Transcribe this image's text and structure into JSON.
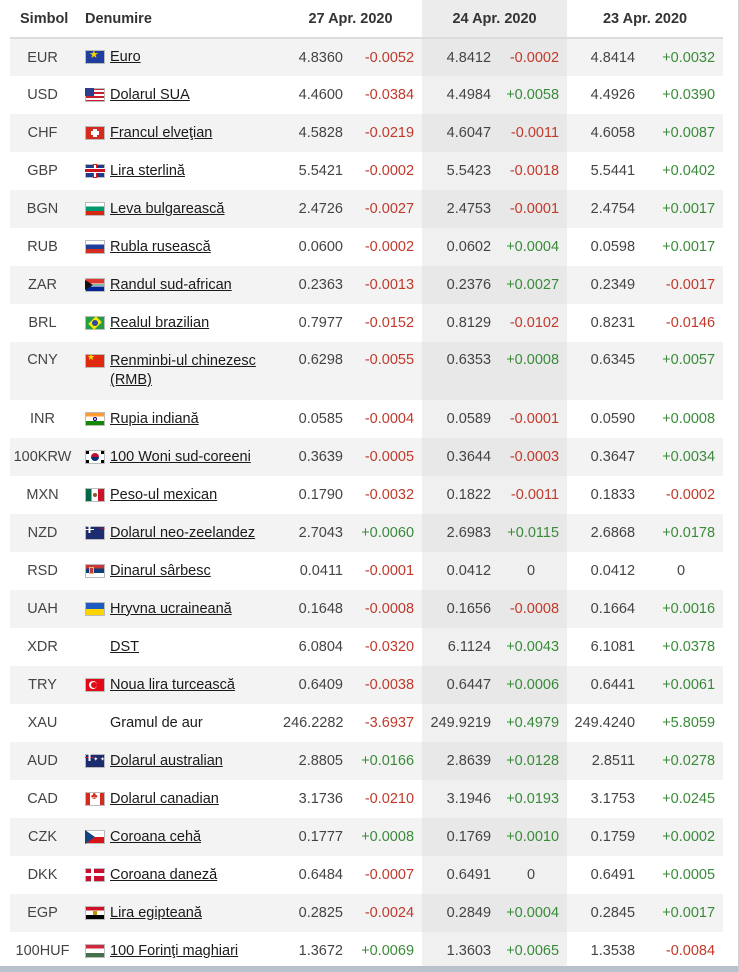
{
  "headers": {
    "symbol": "Simbol",
    "name": "Denumire",
    "dates": [
      "27 Apr. 2020",
      "24 Apr. 2020",
      "23 Apr. 2020"
    ]
  },
  "colors": {
    "negative": "#c0392b",
    "positive": "#3a8a3a",
    "shaded_column": "#e8e8e8",
    "odd_row": "#f3f3f3"
  },
  "rows": [
    {
      "symbol": "EUR",
      "name": "Euro",
      "flag": "eu-flag-icon",
      "linked": true,
      "v1": "4.8360",
      "c1": "-0.0052",
      "v2": "4.8412",
      "c2": "-0.0002",
      "v3": "4.8414",
      "c3": "+0.0032"
    },
    {
      "symbol": "USD",
      "name": "Dolarul SUA",
      "flag": "us-flag-icon",
      "linked": true,
      "v1": "4.4600",
      "c1": "-0.0384",
      "v2": "4.4984",
      "c2": "+0.0058",
      "v3": "4.4926",
      "c3": "+0.0390"
    },
    {
      "symbol": "CHF",
      "name": "Francul elveţian",
      "flag": "ch-flag-icon",
      "linked": true,
      "v1": "4.5828",
      "c1": "-0.0219",
      "v2": "4.6047",
      "c2": "-0.0011",
      "v3": "4.6058",
      "c3": "+0.0087"
    },
    {
      "symbol": "GBP",
      "name": "Lira sterlină",
      "flag": "gb-flag-icon",
      "linked": true,
      "v1": "5.5421",
      "c1": "-0.0002",
      "v2": "5.5423",
      "c2": "-0.0018",
      "v3": "5.5441",
      "c3": "+0.0402"
    },
    {
      "symbol": "BGN",
      "name": "Leva bulgarească",
      "flag": "bg-flag-icon",
      "linked": true,
      "v1": "2.4726",
      "c1": "-0.0027",
      "v2": "2.4753",
      "c2": "-0.0001",
      "v3": "2.4754",
      "c3": "+0.0017"
    },
    {
      "symbol": "RUB",
      "name": "Rubla rusească",
      "flag": "ru-flag-icon",
      "linked": true,
      "v1": "0.0600",
      "c1": "-0.0002",
      "v2": "0.0602",
      "c2": "+0.0004",
      "v3": "0.0598",
      "c3": "+0.0017"
    },
    {
      "symbol": "ZAR",
      "name": "Randul sud-african",
      "flag": "za-flag-icon",
      "linked": true,
      "v1": "0.2363",
      "c1": "-0.0013",
      "v2": "0.2376",
      "c2": "+0.0027",
      "v3": "0.2349",
      "c3": "-0.0017"
    },
    {
      "symbol": "BRL",
      "name": "Realul brazilian",
      "flag": "br-flag-icon",
      "linked": true,
      "v1": "0.7977",
      "c1": "-0.0152",
      "v2": "0.8129",
      "c2": "-0.0102",
      "v3": "0.8231",
      "c3": "-0.0146"
    },
    {
      "symbol": "CNY",
      "name": "Renminbi-ul chinezesc (RMB)",
      "flag": "cn-flag-icon",
      "linked": true,
      "tall": true,
      "v1": "0.6298",
      "c1": "-0.0055",
      "v2": "0.6353",
      "c2": "+0.0008",
      "v3": "0.6345",
      "c3": "+0.0057"
    },
    {
      "symbol": "INR",
      "name": "Rupia indiană",
      "flag": "in-flag-icon",
      "linked": true,
      "v1": "0.0585",
      "c1": "-0.0004",
      "v2": "0.0589",
      "c2": "-0.0001",
      "v3": "0.0590",
      "c3": "+0.0008"
    },
    {
      "symbol": "100KRW",
      "name": "100 Woni sud-coreeni",
      "flag": "kr-flag-icon",
      "linked": true,
      "v1": "0.3639",
      "c1": "-0.0005",
      "v2": "0.3644",
      "c2": "-0.0003",
      "v3": "0.3647",
      "c3": "+0.0034"
    },
    {
      "symbol": "MXN",
      "name": "Peso-ul mexican",
      "flag": "mx-flag-icon",
      "linked": true,
      "v1": "0.1790",
      "c1": "-0.0032",
      "v2": "0.1822",
      "c2": "-0.0011",
      "v3": "0.1833",
      "c3": "-0.0002"
    },
    {
      "symbol": "NZD",
      "name": "Dolarul neo-zeelandez",
      "flag": "nz-flag-icon",
      "linked": true,
      "v1": "2.7043",
      "c1": "+0.0060",
      "v2": "2.6983",
      "c2": "+0.0115",
      "v3": "2.6868",
      "c3": "+0.0178"
    },
    {
      "symbol": "RSD",
      "name": "Dinarul sârbesc",
      "flag": "rs-flag-icon",
      "linked": true,
      "v1": "0.0411",
      "c1": "-0.0001",
      "v2": "0.0412",
      "c2": "0",
      "v3": "0.0412",
      "c3": "0"
    },
    {
      "symbol": "UAH",
      "name": "Hryvna ucraineană",
      "flag": "ua-flag-icon",
      "linked": true,
      "v1": "0.1648",
      "c1": "-0.0008",
      "v2": "0.1656",
      "c2": "-0.0008",
      "v3": "0.1664",
      "c3": "+0.0016"
    },
    {
      "symbol": "XDR",
      "name": "DST",
      "flag": "",
      "linked": true,
      "v1": "6.0804",
      "c1": "-0.0320",
      "v2": "6.1124",
      "c2": "+0.0043",
      "v3": "6.1081",
      "c3": "+0.0378"
    },
    {
      "symbol": "TRY",
      "name": "Noua lira turcească",
      "flag": "tr-flag-icon",
      "linked": true,
      "v1": "0.6409",
      "c1": "-0.0038",
      "v2": "0.6447",
      "c2": "+0.0006",
      "v3": "0.6441",
      "c3": "+0.0061"
    },
    {
      "symbol": "XAU",
      "name": "Gramul de aur",
      "flag": "",
      "linked": false,
      "v1": "246.2282",
      "c1": "-3.6937",
      "v2": "249.9219",
      "c2": "+0.4979",
      "v3": "249.4240",
      "c3": "+5.8059"
    },
    {
      "symbol": "AUD",
      "name": "Dolarul australian",
      "flag": "au-flag-icon",
      "linked": true,
      "v1": "2.8805",
      "c1": "+0.0166",
      "v2": "2.8639",
      "c2": "+0.0128",
      "v3": "2.8511",
      "c3": "+0.0278"
    },
    {
      "symbol": "CAD",
      "name": "Dolarul canadian",
      "flag": "ca-flag-icon",
      "linked": true,
      "v1": "3.1736",
      "c1": "-0.0210",
      "v2": "3.1946",
      "c2": "+0.0193",
      "v3": "3.1753",
      "c3": "+0.0245"
    },
    {
      "symbol": "CZK",
      "name": "Coroana cehă",
      "flag": "cz-flag-icon",
      "linked": true,
      "v1": "0.1777",
      "c1": "+0.0008",
      "v2": "0.1769",
      "c2": "+0.0010",
      "v3": "0.1759",
      "c3": "+0.0002"
    },
    {
      "symbol": "DKK",
      "name": "Coroana daneză",
      "flag": "dk-flag-icon",
      "linked": true,
      "v1": "0.6484",
      "c1": "-0.0007",
      "v2": "0.6491",
      "c2": "0",
      "v3": "0.6491",
      "c3": "+0.0005"
    },
    {
      "symbol": "EGP",
      "name": "Lira egipteană",
      "flag": "eg-flag-icon",
      "linked": true,
      "v1": "0.2825",
      "c1": "-0.0024",
      "v2": "0.2849",
      "c2": "+0.0004",
      "v3": "0.2845",
      "c3": "+0.0017"
    },
    {
      "symbol": "100HUF",
      "name": "100 Forinţi maghiari",
      "flag": "hu-flag-icon",
      "linked": true,
      "v1": "1.3672",
      "c1": "+0.0069",
      "v2": "1.3603",
      "c2": "+0.0065",
      "v3": "1.3538",
      "c3": "-0.0084"
    }
  ]
}
